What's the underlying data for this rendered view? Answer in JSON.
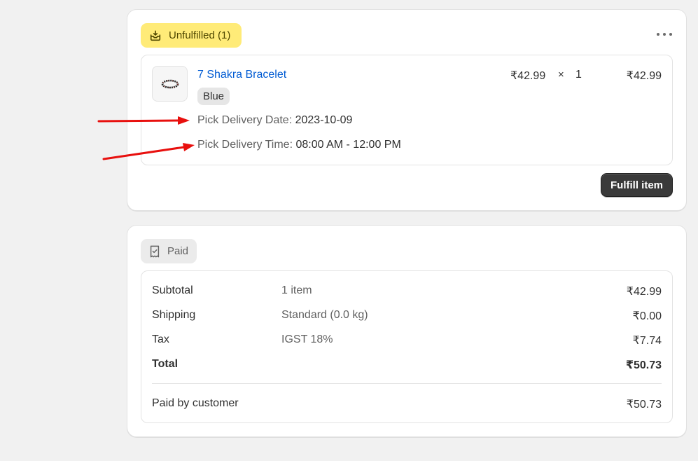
{
  "fulfillment": {
    "status_badge": "Unfulfilled (1)",
    "more_actions_icon": "ellipsis-horizontal-icon",
    "line_item": {
      "title": "7 Shakra Bracelet",
      "variant": "Blue",
      "properties": [
        {
          "key": "Pick Delivery Date:",
          "value": "2023-10-09"
        },
        {
          "key": "Pick Delivery Time:",
          "value": "08:00 AM - 12:00 PM"
        }
      ],
      "unit_price": "₹42.99",
      "times": "×",
      "quantity": "1",
      "total": "₹42.99"
    },
    "fulfill_button": "Fulfill item"
  },
  "payment": {
    "status_badge": "Paid",
    "rows": [
      {
        "label": "Subtotal",
        "detail": "1 item",
        "amount": "₹42.99"
      },
      {
        "label": "Shipping",
        "detail": "Standard (0.0 kg)",
        "amount": "₹0.00"
      },
      {
        "label": "Tax",
        "detail": "IGST 18%",
        "amount": "₹7.74"
      },
      {
        "label": "Total",
        "detail": "",
        "amount": "₹50.73"
      }
    ],
    "paid_by_customer": {
      "label": "Paid by customer",
      "amount": "₹50.73"
    }
  },
  "colors": {
    "unfulfilled_badge_bg": "#ffeb78",
    "paid_badge_bg": "#ebebeb",
    "link_blue": "#005bd3",
    "annotation_arrow_red": "#e8100e",
    "primary_button": "#303030"
  }
}
